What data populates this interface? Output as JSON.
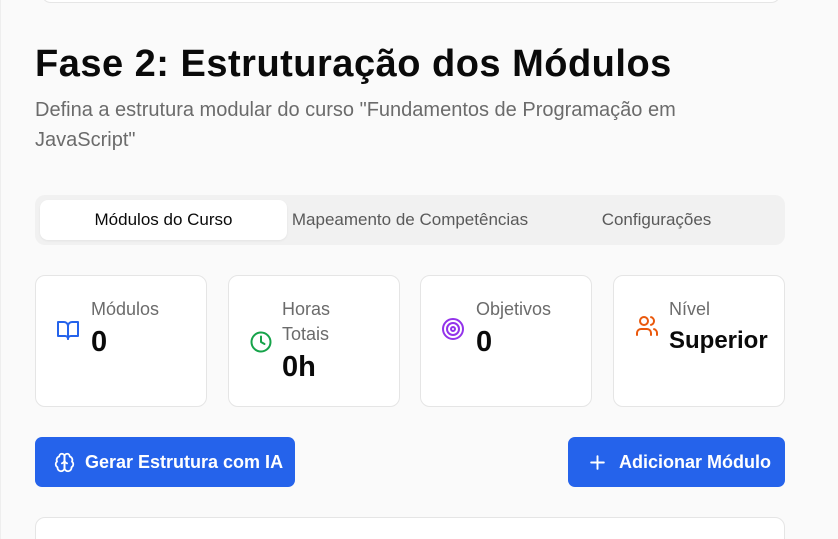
{
  "header": {
    "title": "Fase 2: Estruturação dos Módulos",
    "subtitle": "Defina a estrutura modular do curso \"Fundamentos de Programação em JavaScript\""
  },
  "tabs": [
    {
      "label": "Módulos do Curso",
      "active": true
    },
    {
      "label": "Mapeamento de Competências",
      "active": false
    },
    {
      "label": "Configurações",
      "active": false
    }
  ],
  "stats": {
    "modules": {
      "label": "Módulos",
      "value": "0",
      "icon": "book-open-icon",
      "color": "#2563eb"
    },
    "hours": {
      "label": "Horas Totais",
      "value": "0h",
      "icon": "clock-icon",
      "color": "#16a34a"
    },
    "objectives": {
      "label": "Objetivos",
      "value": "0",
      "icon": "target-icon",
      "color": "#9333ea"
    },
    "level": {
      "label": "Nível",
      "value": "Superior",
      "icon": "users-icon",
      "color": "#ea580c"
    }
  },
  "actions": {
    "generate_label": "Gerar Estrutura com IA",
    "generate_icon": "brain-icon",
    "add_label": "Adicionar Módulo",
    "add_icon": "plus-icon",
    "accent": "#2563eb"
  }
}
